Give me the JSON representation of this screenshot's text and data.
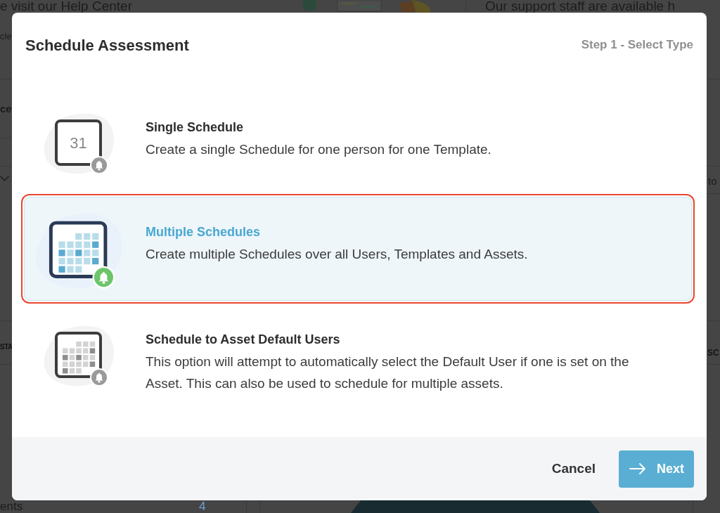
{
  "background_page": {
    "header_left": "e visit our Help Center",
    "header_right": "Our support staff are available h",
    "left_fragments": [
      "cle",
      "ce",
      "STA",
      "ents"
    ],
    "left_count": "4",
    "right_fragments": [
      "to",
      "SC"
    ]
  },
  "dialog": {
    "title": "Schedule Assessment",
    "step": "Step 1 - Select Type",
    "options": [
      {
        "kind": "single",
        "date": "31",
        "title": "Single Schedule",
        "description": "Create a single Schedule for one person for one Template.",
        "selected": false
      },
      {
        "kind": "multiple",
        "title": "Multiple Schedules",
        "description": "Create multiple Schedules over all Users, Templates and Assets.",
        "selected": true
      },
      {
        "kind": "multiple",
        "title": "Schedule to Asset Default Users",
        "description": "This option will attempt to automatically select the Default User if one is set on the Asset. This can also be used to schedule for multiple assets.",
        "selected": false
      }
    ],
    "buttons": [
      {
        "kind": "secondary",
        "label": "Cancel"
      },
      {
        "kind": "primary",
        "label": "Next"
      }
    ]
  }
}
